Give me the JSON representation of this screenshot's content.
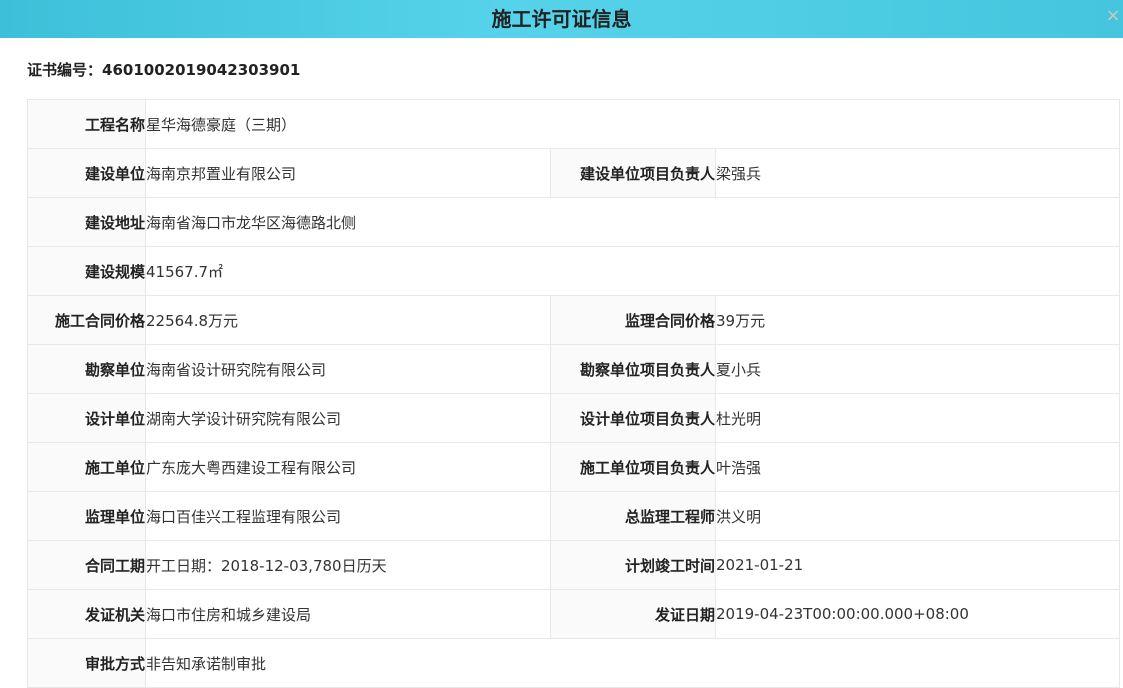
{
  "header": {
    "title": "施工许可证信息",
    "close_icon": "close-icon"
  },
  "certificate": {
    "label": "证书编号：",
    "number": "4601002019042303901"
  },
  "rows": [
    {
      "label": "工程名称",
      "value": "星华海德豪庭（三期）"
    },
    {
      "label": "建设单位",
      "value": "海南京邦置业有限公司",
      "label2": "建设单位项目负责人",
      "value2": "梁强兵"
    },
    {
      "label": "建设地址",
      "value": "海南省海口市龙华区海德路北侧"
    },
    {
      "label": "建设规模",
      "value": "41567.7㎡"
    },
    {
      "label": "施工合同价格",
      "value": "22564.8万元",
      "label2": "监理合同价格",
      "value2": "39万元"
    },
    {
      "label": "勘察单位",
      "value": "海南省设计研究院有限公司",
      "label2": "勘察单位项目负责人",
      "value2": "夏小兵"
    },
    {
      "label": "设计单位",
      "value": "湖南大学设计研究院有限公司",
      "label2": "设计单位项目负责人",
      "value2": "杜光明"
    },
    {
      "label": "施工单位",
      "value": "广东庞大粤西建设工程有限公司",
      "label2": "施工单位项目负责人",
      "value2": "叶浩强"
    },
    {
      "label": "监理单位",
      "value": "海口百佳兴工程监理有限公司",
      "label2": "总监理工程师",
      "value2": "洪义明"
    },
    {
      "label": "合同工期",
      "value": "开工日期：2018-12-03,780日历天",
      "label2": "计划竣工时间",
      "value2": "2021-01-21"
    },
    {
      "label": "发证机关",
      "value": "海口市住房和城乡建设局",
      "label2": "发证日期",
      "value2": "2019-04-23T00:00:00.000+08:00"
    },
    {
      "label": "审批方式",
      "value": "非告知承诺制审批"
    }
  ]
}
